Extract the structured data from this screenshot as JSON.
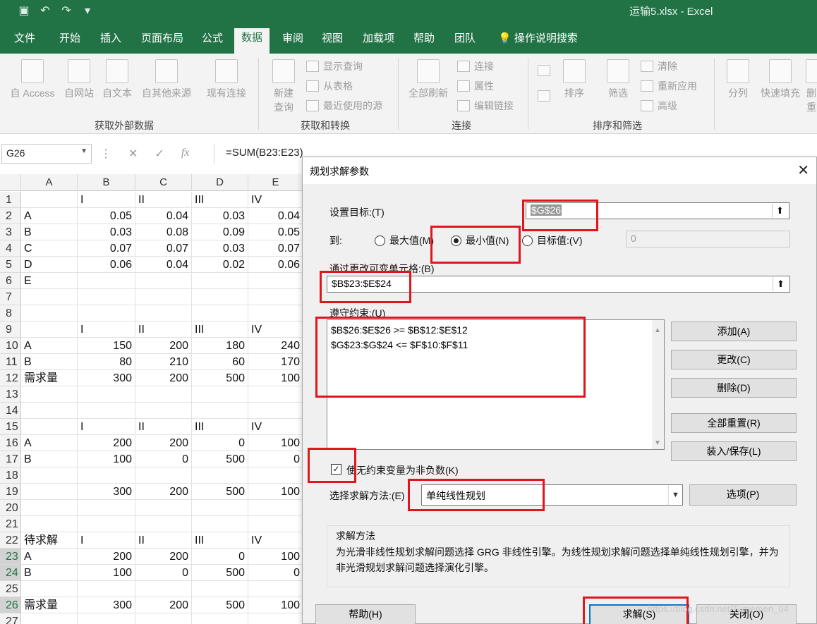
{
  "window": {
    "title": "运输5.xlsx  -  Excel"
  },
  "qat": {
    "save_icon": "save-icon",
    "undo_icon": "undo-icon",
    "redo_icon": "redo-icon",
    "customize_icon": "customize-icon"
  },
  "tabs": [
    "文件",
    "开始",
    "插入",
    "页面布局",
    "公式",
    "数据",
    "审阅",
    "视图",
    "加载项",
    "帮助",
    "团队",
    "操作说明搜索"
  ],
  "active_tab": "数据",
  "ribbon": {
    "groups": {
      "external": {
        "label": "获取外部数据",
        "buttons": [
          "自 Access",
          "自网站",
          "自文本",
          "自其他来源",
          "现有连接"
        ]
      },
      "transform": {
        "label": "获取和转换",
        "new_query": "新建",
        "new_query_2": "查询",
        "show_queries": "显示查询",
        "from_table": "从表格",
        "recent_sources": "最近使用的源"
      },
      "connections": {
        "label": "连接",
        "refresh_all": "全部刷新",
        "connections": "连接",
        "properties": "属性",
        "edit_links": "编辑链接"
      },
      "sort_filter": {
        "label": "排序和筛选",
        "sort": "排序",
        "filter": "筛选",
        "clear": "清除",
        "reapply": "重新应用",
        "advanced": "高级"
      },
      "tools": {
        "split": "分列",
        "flash_fill": "快速填充",
        "more": "删",
        "more2": "重"
      }
    }
  },
  "formula_bar": {
    "name_box": "G26",
    "cancel": "✕",
    "enter": "✓",
    "fx": "fx",
    "formula": "=SUM(B23:E23)"
  },
  "sheet": {
    "columns": [
      "A",
      "B",
      "C",
      "D",
      "E"
    ],
    "rows": [
      {
        "n": "1",
        "cells": [
          "",
          "I",
          "II",
          "III",
          "IV"
        ]
      },
      {
        "n": "2",
        "cells": [
          "A",
          "0.05",
          "0.04",
          "0.03",
          "0.04"
        ]
      },
      {
        "n": "3",
        "cells": [
          "B",
          "0.03",
          "0.08",
          "0.09",
          "0.05"
        ]
      },
      {
        "n": "4",
        "cells": [
          "C",
          "0.07",
          "0.07",
          "0.03",
          "0.07"
        ]
      },
      {
        "n": "5",
        "cells": [
          "D",
          "0.06",
          "0.04",
          "0.02",
          "0.06"
        ]
      },
      {
        "n": "6",
        "cells": [
          "E",
          "",
          "",
          "",
          ""
        ]
      },
      {
        "n": "7",
        "cells": [
          "",
          "",
          "",
          "",
          ""
        ]
      },
      {
        "n": "8",
        "cells": [
          "",
          "",
          "",
          "",
          ""
        ]
      },
      {
        "n": "9",
        "cells": [
          "",
          "I",
          "II",
          "III",
          "IV"
        ]
      },
      {
        "n": "10",
        "cells": [
          "A",
          "150",
          "200",
          "180",
          "240"
        ]
      },
      {
        "n": "11",
        "cells": [
          "B",
          "80",
          "210",
          "60",
          "170"
        ]
      },
      {
        "n": "12",
        "cells": [
          "需求量",
          "300",
          "200",
          "500",
          "100"
        ]
      },
      {
        "n": "13",
        "cells": [
          "",
          "",
          "",
          "",
          ""
        ]
      },
      {
        "n": "14",
        "cells": [
          "",
          "",
          "",
          "",
          ""
        ]
      },
      {
        "n": "15",
        "cells": [
          "",
          "I",
          "II",
          "III",
          "IV"
        ]
      },
      {
        "n": "16",
        "cells": [
          "A",
          "200",
          "200",
          "0",
          "100"
        ]
      },
      {
        "n": "17",
        "cells": [
          "B",
          "100",
          "0",
          "500",
          "0"
        ]
      },
      {
        "n": "18",
        "cells": [
          "",
          "",
          "",
          "",
          ""
        ]
      },
      {
        "n": "19",
        "cells": [
          "",
          "300",
          "200",
          "500",
          "100"
        ]
      },
      {
        "n": "20",
        "cells": [
          "",
          "",
          "",
          "",
          ""
        ]
      },
      {
        "n": "21",
        "cells": [
          "",
          "",
          "",
          "",
          ""
        ]
      },
      {
        "n": "22",
        "cells": [
          "待求解",
          "I",
          "II",
          "III",
          "IV"
        ]
      },
      {
        "n": "23",
        "cells": [
          "A",
          "200",
          "200",
          "0",
          "100"
        ]
      },
      {
        "n": "24",
        "cells": [
          "B",
          "100",
          "0",
          "500",
          "0"
        ]
      },
      {
        "n": "25",
        "cells": [
          "",
          "",
          "",
          "",
          ""
        ]
      },
      {
        "n": "26",
        "cells": [
          "需求量",
          "300",
          "200",
          "500",
          "100"
        ]
      },
      {
        "n": "27",
        "cells": [
          "",
          "",
          "",
          "",
          ""
        ]
      }
    ]
  },
  "dialog": {
    "title": "规划求解参数",
    "objective_label": "设置目标:(T)",
    "objective_value": "$G$26",
    "to_label": "到:",
    "opt_max": "最大值(M)",
    "opt_min": "最小值(N)",
    "opt_target": "目标值:(V)",
    "target_value": "0",
    "changing_label": "通过更改可变单元格:(B)",
    "changing_value": "$B$23:$E$24",
    "constraints_label": "遵守约束:(U)",
    "constraints": [
      "$B$26:$E$26 >= $B$12:$E$12",
      "$G$23:$G$24 <= $F$10:$F$11"
    ],
    "btn_add": "添加(A)",
    "btn_change": "更改(C)",
    "btn_delete": "删除(D)",
    "btn_reset": "全部重置(R)",
    "btn_load": "装入/保存(L)",
    "nonneg_label": "使无约束变量为非负数(K)",
    "method_label": "选择求解方法:(E)",
    "method_value": "单纯线性规划",
    "btn_options": "选项(P)",
    "desc_title": "求解方法",
    "desc_text": "为光滑非线性规划求解问题选择 GRG 非线性引擎。为线性规划求解问题选择单纯线性规划引擎，并为非光滑规划求解问题选择演化引擎。",
    "btn_help": "帮助(H)",
    "btn_solve": "求解(S)",
    "btn_close": "关闭(O)"
  },
  "colors": {
    "excel_green": "#217346",
    "annotation_red": "#e0161f"
  },
  "watermark": "https://blog.csdn.net/Tumemen_04"
}
